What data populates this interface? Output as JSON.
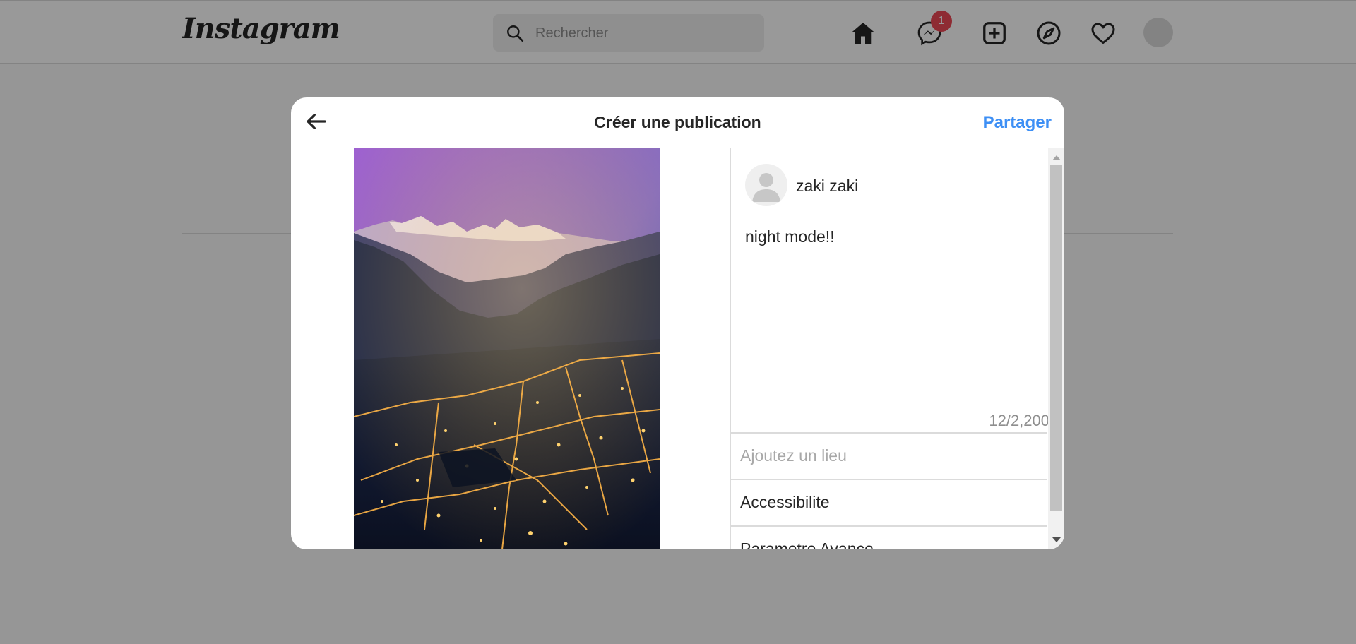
{
  "header": {
    "logo_text": "Instagram",
    "search_placeholder": "Rechercher",
    "messages_badge": "1",
    "icons": [
      "home-icon",
      "messenger-icon",
      "new-post-icon",
      "explore-icon",
      "heart-icon",
      "profile-avatar"
    ]
  },
  "modal": {
    "title": "Créer une publication",
    "share_label": "Partager",
    "back_icon": "arrow-left-icon"
  },
  "post": {
    "username": "zaki zaki",
    "caption": "night mode!!",
    "char_counter": "12/2,200",
    "location_placeholder": "Ajoutez un lieu",
    "accessibility_label": "Accessibilite",
    "advanced_label": "Parametre Avance"
  },
  "colors": {
    "accent": "#3d8ff5",
    "badge": "#ed4956",
    "overlay": "rgba(0,0,0,0.4)"
  }
}
